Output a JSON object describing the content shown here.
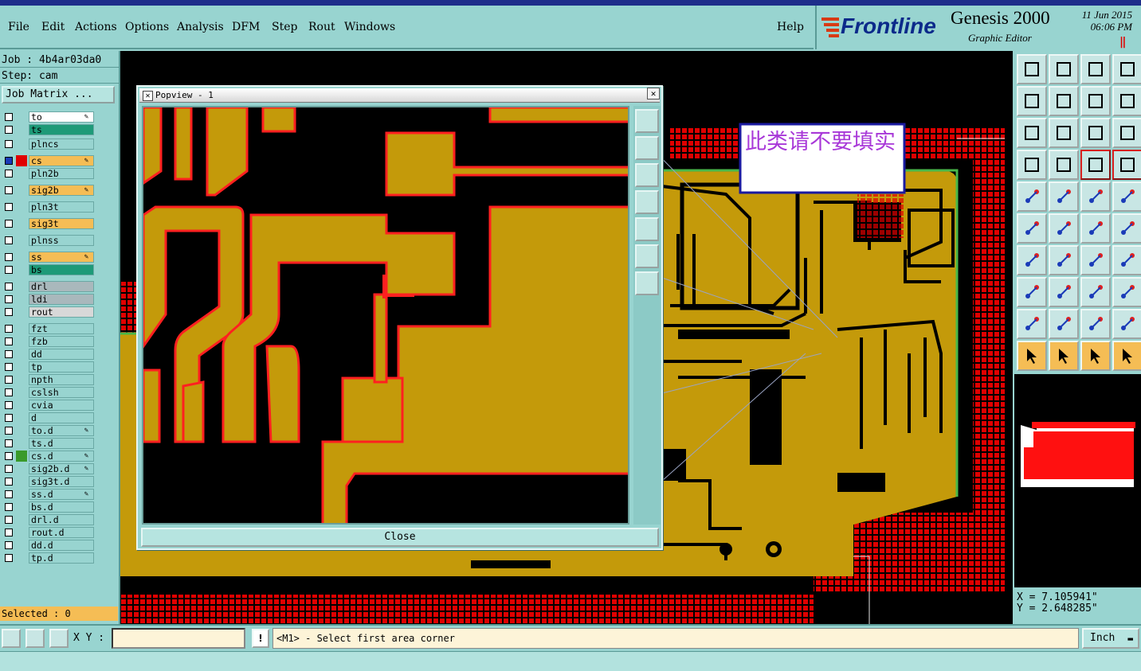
{
  "menubar": {
    "items": [
      "File",
      "Edit",
      "Actions",
      "Options",
      "Analysis",
      "DFM",
      "Step",
      "Rout",
      "Windows"
    ],
    "help": "Help"
  },
  "brand": {
    "name": "Frontline",
    "product": "Genesis 2000",
    "subtitle": "Graphic Editor",
    "date": "11 Jun 2015",
    "time": "06:06 PM",
    "pause_glyph": "‖"
  },
  "left": {
    "job": "Job : 4b4ar03da0",
    "step": "Step: cam",
    "job_matrix": "Job Matrix ...",
    "selected": "Selected : 0"
  },
  "layers": [
    {
      "name": "to",
      "color": "#ffffff",
      "swatch": "#98d4d0",
      "edit": true
    },
    {
      "name": "ts",
      "color": "#1e9a78",
      "swatch": "#98d4d0",
      "edit": false
    },
    {
      "name": "plncs",
      "color": "#98d4d0",
      "swatch": "#98d4d0",
      "edit": false
    },
    {
      "name": "cs",
      "color": "#f5bd55",
      "swatch": "#e00000",
      "edit": true,
      "active": true
    },
    {
      "name": "pln2b",
      "color": "#98d4d0",
      "swatch": "#98d4d0",
      "edit": false
    },
    {
      "name": "sig2b",
      "color": "#f5bd55",
      "swatch": "#98d4d0",
      "edit": true
    },
    {
      "name": "pln3t",
      "color": "#98d4d0",
      "swatch": "#98d4d0",
      "edit": false
    },
    {
      "name": "sig3t",
      "color": "#f5bd55",
      "swatch": "#98d4d0",
      "edit": false
    },
    {
      "name": "plnss",
      "color": "#98d4d0",
      "swatch": "#98d4d0",
      "edit": false
    },
    {
      "name": "ss",
      "color": "#f5bd55",
      "swatch": "#98d4d0",
      "edit": true
    },
    {
      "name": "bs",
      "color": "#1e9a78",
      "swatch": "#98d4d0",
      "edit": false
    },
    {
      "name": "drl",
      "color": "#a9b8bc",
      "swatch": "#98d4d0",
      "edit": false
    },
    {
      "name": "ldi",
      "color": "#a9b8bc",
      "swatch": "#98d4d0",
      "edit": false
    },
    {
      "name": "rout",
      "color": "#d8d8d8",
      "swatch": "#98d4d0",
      "edit": false
    },
    {
      "name": "fzt",
      "color": "#98d4d0",
      "swatch": "#98d4d0",
      "edit": false
    },
    {
      "name": "fzb",
      "color": "#98d4d0",
      "swatch": "#98d4d0",
      "edit": false
    },
    {
      "name": "dd",
      "color": "#98d4d0",
      "swatch": "#98d4d0",
      "edit": false
    },
    {
      "name": "tp",
      "color": "#98d4d0",
      "swatch": "#98d4d0",
      "edit": false
    },
    {
      "name": "npth",
      "color": "#98d4d0",
      "swatch": "#98d4d0",
      "edit": false
    },
    {
      "name": "cslsh",
      "color": "#98d4d0",
      "swatch": "#98d4d0",
      "edit": false
    },
    {
      "name": "cvia",
      "color": "#98d4d0",
      "swatch": "#98d4d0",
      "edit": false
    },
    {
      "name": "d",
      "color": "#98d4d0",
      "swatch": "#98d4d0",
      "edit": false
    },
    {
      "name": "to.d",
      "color": "#98d4d0",
      "swatch": "#98d4d0",
      "edit": true
    },
    {
      "name": "ts.d",
      "color": "#98d4d0",
      "swatch": "#98d4d0",
      "edit": false
    },
    {
      "name": "cs.d",
      "color": "#98d4d0",
      "swatch": "#3a9a2a",
      "edit": true
    },
    {
      "name": "sig2b.d",
      "color": "#98d4d0",
      "swatch": "#98d4d0",
      "edit": true
    },
    {
      "name": "sig3t.d",
      "color": "#98d4d0",
      "swatch": "#98d4d0",
      "edit": false
    },
    {
      "name": "ss.d",
      "color": "#98d4d0",
      "swatch": "#98d4d0",
      "edit": true
    },
    {
      "name": "bs.d",
      "color": "#98d4d0",
      "swatch": "#98d4d0",
      "edit": false
    },
    {
      "name": "drl.d",
      "color": "#98d4d0",
      "swatch": "#98d4d0",
      "edit": false
    },
    {
      "name": "rout.d",
      "color": "#98d4d0",
      "swatch": "#98d4d0",
      "edit": false
    },
    {
      "name": "dd.d",
      "color": "#98d4d0",
      "swatch": "#98d4d0",
      "edit": false
    },
    {
      "name": "tp.d",
      "color": "#98d4d0",
      "swatch": "#98d4d0",
      "edit": false
    }
  ],
  "popview": {
    "title": "Popview - 1",
    "close_label": "Close",
    "close_x": "✕"
  },
  "annotation": {
    "text": "此类请不要填实"
  },
  "coords": {
    "x": "X = 7.105941\"",
    "y": "Y = 2.648285\""
  },
  "status": {
    "xy_label": "X Y :",
    "xy_value": "",
    "warn_glyph": "!",
    "prompt": "<M1> - Select first area corner",
    "units": "Inch",
    "units_arrow": "▬"
  },
  "colors": {
    "board": "#c49a0a",
    "outline": "#e00000",
    "copper_edge": "#ff2020",
    "ui_teal": "#98d4d0",
    "highlight_orange": "#f5bd55"
  },
  "icons": [
    "popview-fit-icon",
    "popview-zoom-home-icon",
    "popview-zoom-in-icon",
    "popview-pan-left-icon",
    "popview-pan-right-icon",
    "popview-zoom-out-icon",
    "popview-center-icon"
  ]
}
